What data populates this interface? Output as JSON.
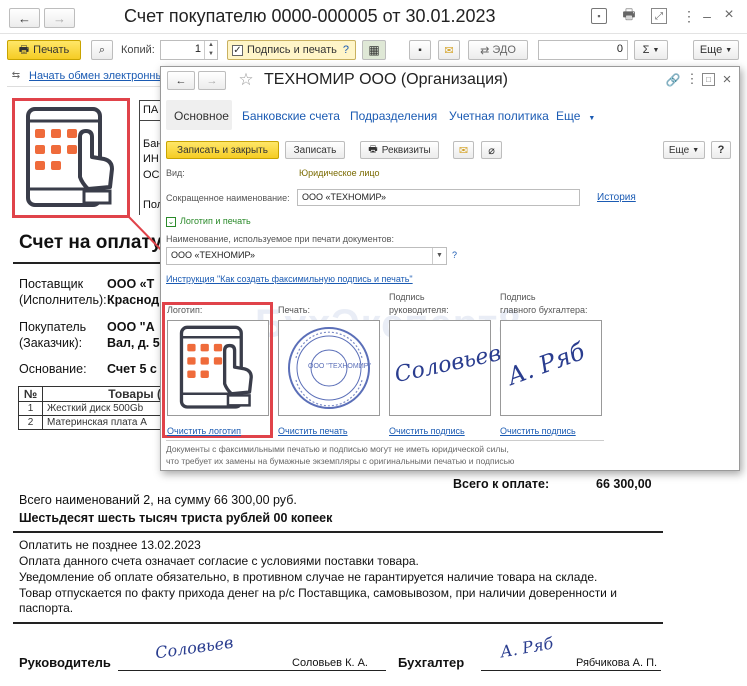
{
  "window": {
    "title": "Счет покупателю 0000-000005 от 30.01.2023"
  },
  "toolbar": {
    "print_label": "Печать",
    "copies_label": "Копий:",
    "copies_value": "1",
    "sign_print_label": "Подпись и печать",
    "help": "?",
    "edo_label": "ЭДО",
    "sum_value": "0",
    "sigma": "Σ",
    "more_label": "Еще"
  },
  "exchange_link": "Начать обмен электронны",
  "doc": {
    "pa_partial": "ПА",
    "bank_partial": "Бан",
    "inn_partial": "ИН",
    "os_partial": "ОС",
    "pol_partial": "Пол",
    "heading": "Счет на оплату",
    "supplier_label_1": "Поставщик",
    "supplier_label_2": "(Исполнитель):",
    "supplier_val_1": "ООО «Т",
    "supplier_val_2": "Краснод",
    "buyer_label_1": "Покупатель",
    "buyer_label_2": "(Заказчик):",
    "buyer_val_1": "ООО \"А",
    "buyer_val_2": "Вал, д. 5",
    "basis_label": "Основание:",
    "basis_val": "Счет 5 с",
    "table_headers": [
      "№",
      "Товары ("
    ],
    "rows": [
      {
        "n": "1",
        "name": "Жесткий диск 500Gb"
      },
      {
        "n": "2",
        "name": "Материнская плата A"
      }
    ],
    "total_label": "Всего к оплате:",
    "total_value": "66 300,00",
    "summary_1": "Всего наименований 2, на сумму 66 300,00 руб.",
    "summary_2": "Шестьдесят шесть тысяч триста рублей 00 копеек",
    "note_1": "Оплатить не позднее 13.02.2023",
    "note_2": "Оплата данного счета означает согласие с условиями поставки товара.",
    "note_3": "Уведомление об оплате обязательно, в противном случае не гарантируется наличие товара на складе.",
    "note_4": "Товар отпускается по факту прихода денег на р/с Поставщика, самовывозом, при наличии доверенности и",
    "note_5": "паспорта.",
    "head_label": "Руководитель",
    "head_name": "Соловьев К. А.",
    "acc_label": "Бухгалтер",
    "acc_name": "Рябчикова А. П.",
    "head_sig": "Соловьев",
    "acc_sig": "А. Ряб"
  },
  "dialog": {
    "title": "ТЕХНОМИР ООО (Организация)",
    "tabs": [
      "Основное",
      "Банковские счета",
      "Подразделения",
      "Учетная политика",
      "Еще"
    ],
    "save_close": "Записать и закрыть",
    "save": "Записать",
    "requisites": "Реквизиты",
    "more": "Еще",
    "help": "?",
    "type_label": "Вид:",
    "type_value": "Юридическое лицо",
    "short_name_label": "Сокращенное наименование:",
    "short_name_value": "ООО «ТЕХНОМИР»",
    "history": "История",
    "logo_section": "Логотип и печать",
    "print_name_label": "Наименование, используемое при печати документов:",
    "print_name_value": "ООО «ТЕХНОМИР»",
    "q": "?",
    "instruction": "Инструкция \"Как создать факсимильную подпись и печать\"",
    "logo_label": "Логотип:",
    "stamp_label": "Печать:",
    "head_sign_label_1": "Подпись",
    "head_sign_label_2": "руководителя:",
    "acc_sign_label_1": "Подпись",
    "acc_sign_label_2": "главного бухгалтера:",
    "clear_logo": "Очистить логотип",
    "clear_stamp": "Очистить печать",
    "clear_sign_1": "Очистить подпись",
    "clear_sign_2": "Очистить подпись",
    "disclaimer_1": "Документы с факсимильными печатью и подписью могут не иметь юридической силы,",
    "disclaimer_2": "что требует их замены на бумажные экземпляры с оригинальными печатью и подписью",
    "stamp_text": "ООО \"ТЕХНОМИР\"",
    "watermark": "БухЭксперт8",
    "sig_1": "Соловьев",
    "sig_2": "А. Ряб"
  },
  "colors": {
    "accent": "#e0434a",
    "logo_red": "#ef6b3b",
    "link": "#1b5bb3",
    "yellow": "#f5cc24"
  }
}
